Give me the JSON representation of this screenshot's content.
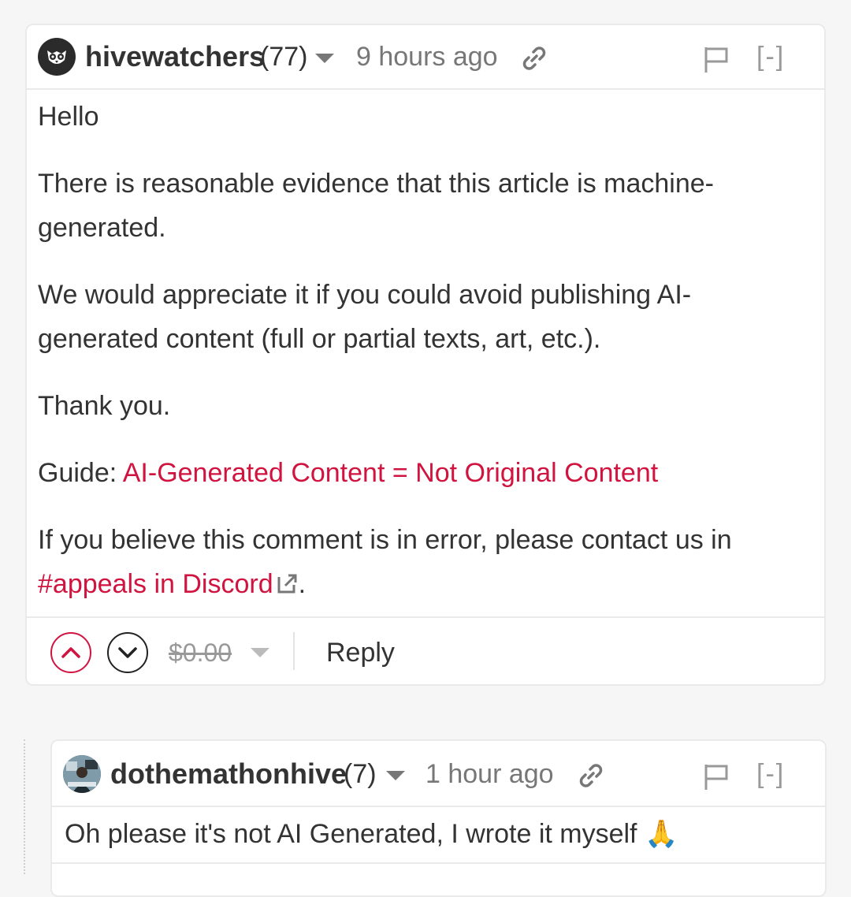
{
  "comment1": {
    "author": "hivewatchers",
    "reputation": "(77)",
    "time": "9 hours ago",
    "collapse": "[-]",
    "paragraphs": {
      "p1": "Hello",
      "p2": "There is reasonable evidence that this article is machine-generated.",
      "p3": "We would appreciate it if you could avoid publishing AI-generated content (full or partial texts, art, etc.).",
      "p4": "Thank you.",
      "guide_label": "Guide: ",
      "guide_link": "AI-Generated Content = Not Original Content",
      "appeal_text": "If you believe this comment is in error, please contact us in ",
      "appeal_link": "#appeals in Discord",
      "appeal_end": "."
    },
    "payout": "$0.00",
    "reply_label": "Reply"
  },
  "comment2": {
    "author": "dothemathonhive",
    "reputation": "(7)",
    "time": "1 hour ago",
    "collapse": "[-]",
    "text": "Oh please it's not AI Generated, I wrote it myself",
    "emoji": "🙏"
  },
  "colors": {
    "link": "#d1143f",
    "border": "#eaeaea",
    "muted": "#777777"
  },
  "icons": [
    "owl-avatar-icon",
    "link-icon",
    "flag-icon",
    "caret-down-icon",
    "upvote-icon",
    "downvote-icon",
    "external-link-icon"
  ]
}
